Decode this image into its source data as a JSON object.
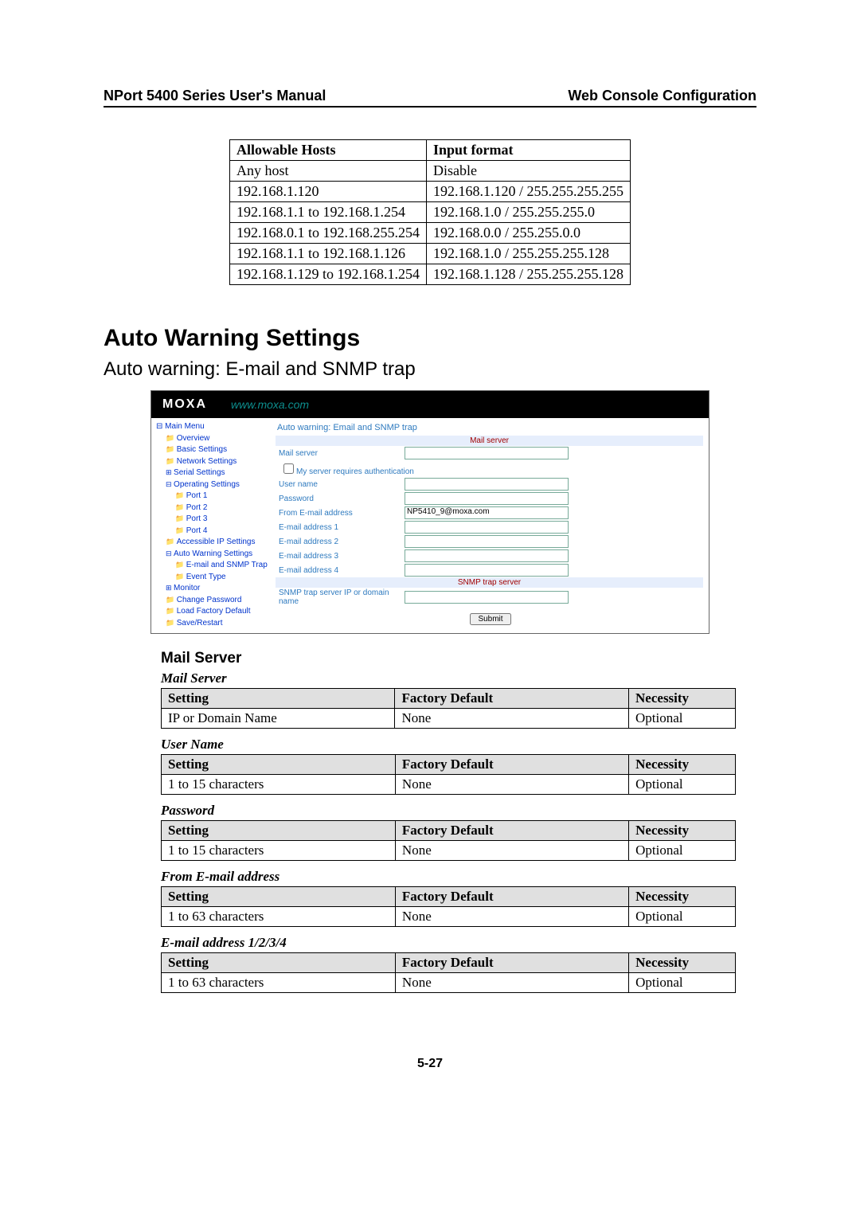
{
  "header": {
    "left": "NPort 5400 Series User's Manual",
    "right": "Web Console Configuration"
  },
  "hosts_table": {
    "headers": [
      "Allowable Hosts",
      "Input format"
    ],
    "rows": [
      [
        "Any host",
        "Disable"
      ],
      [
        "192.168.1.120",
        "192.168.1.120 / 255.255.255.255"
      ],
      [
        "192.168.1.1 to 192.168.1.254",
        "192.168.1.0 / 255.255.255.0"
      ],
      [
        "192.168.0.1 to 192.168.255.254",
        "192.168.0.0 / 255.255.0.0"
      ],
      [
        "192.168.1.1 to 192.168.1.126",
        "192.168.1.0 / 255.255.255.128"
      ],
      [
        "192.168.1.129 to 192.168.1.254",
        "192.168.1.128 / 255.255.255.128"
      ]
    ]
  },
  "section_title": "Auto Warning Settings",
  "subsection_title": "Auto warning: E-mail and SNMP trap",
  "screenshot": {
    "logo": "MOXA",
    "url": "www.moxa.com",
    "tree": [
      {
        "t": "Main Menu",
        "cls": "item boxminus"
      },
      {
        "t": "Overview",
        "cls": "item indent1 folder"
      },
      {
        "t": "Basic Settings",
        "cls": "item indent1 folder"
      },
      {
        "t": "Network Settings",
        "cls": "item indent1 folder"
      },
      {
        "t": "Serial Settings",
        "cls": "item indent1 box folder"
      },
      {
        "t": "Operating Settings",
        "cls": "item indent1 boxminus folder"
      },
      {
        "t": "Port 1",
        "cls": "item indent2 folder"
      },
      {
        "t": "Port 2",
        "cls": "item indent2 folder"
      },
      {
        "t": "Port 3",
        "cls": "item indent2 folder"
      },
      {
        "t": "Port 4",
        "cls": "item indent2 folder"
      },
      {
        "t": "Accessible IP Settings",
        "cls": "item indent1 folder"
      },
      {
        "t": "Auto Warning Settings",
        "cls": "item indent1 boxminus folder"
      },
      {
        "t": "E-mail and SNMP Trap",
        "cls": "item indent2 folder"
      },
      {
        "t": "Event Type",
        "cls": "item indent2 folder"
      },
      {
        "t": "Monitor",
        "cls": "item indent1 box folder"
      },
      {
        "t": "Change Password",
        "cls": "item indent1 folder"
      },
      {
        "t": "Load Factory Default",
        "cls": "item indent1 folder"
      },
      {
        "t": "Save/Restart",
        "cls": "item indent1 folder"
      }
    ],
    "content_title": "Auto warning: Email and SNMP trap",
    "mail_server_head": "Mail server",
    "rows": [
      {
        "label": "Mail server",
        "val": ""
      },
      {
        "label": "My server requires authentication",
        "checkbox": true
      },
      {
        "label": "User name",
        "val": ""
      },
      {
        "label": "Password",
        "val": ""
      },
      {
        "label": "From E-mail address",
        "val": "NP5410_9@moxa.com"
      },
      {
        "label": "E-mail address 1",
        "val": ""
      },
      {
        "label": "E-mail address 2",
        "val": ""
      },
      {
        "label": "E-mail address 3",
        "val": ""
      },
      {
        "label": "E-mail address 4",
        "val": ""
      }
    ],
    "snmp_head": "SNMP trap server",
    "snmp_label": "SNMP trap server IP or domain name",
    "submit": "Submit"
  },
  "mail_server_heading": "Mail Server",
  "setting_groups": [
    {
      "title": "Mail Server",
      "headers": [
        "Setting",
        "Factory Default",
        "Necessity"
      ],
      "row": [
        "IP or Domain Name",
        "None",
        "Optional"
      ]
    },
    {
      "title": "User Name",
      "headers": [
        "Setting",
        "Factory Default",
        "Necessity"
      ],
      "row": [
        "1 to 15 characters",
        "None",
        "Optional"
      ]
    },
    {
      "title": "Password",
      "headers": [
        "Setting",
        "Factory Default",
        "Necessity"
      ],
      "row": [
        "1 to 15 characters",
        "None",
        "Optional"
      ]
    },
    {
      "title": "From E-mail address",
      "headers": [
        "Setting",
        "Factory Default",
        "Necessity"
      ],
      "row": [
        "1 to 63 characters",
        "None",
        "Optional"
      ]
    },
    {
      "title": "E-mail address 1/2/3/4",
      "headers": [
        "Setting",
        "Factory Default",
        "Necessity"
      ],
      "row": [
        "1 to 63 characters",
        "None",
        "Optional"
      ]
    }
  ],
  "page_number": "5-27"
}
